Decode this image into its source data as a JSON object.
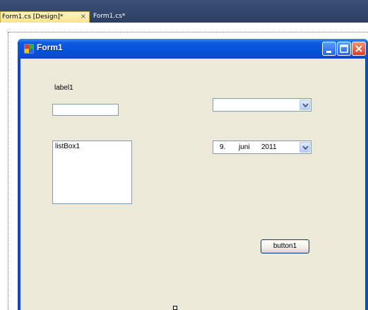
{
  "tabs": [
    {
      "label": "Form1.cs [Design]*",
      "active": true,
      "close_glyph": "×"
    },
    {
      "label": "Form1.cs*",
      "active": false
    }
  ],
  "form": {
    "title": "Form1",
    "icon": "form-app-icon",
    "controls": {
      "label1": "label1",
      "textbox1_value": "",
      "listbox1_items": [
        "listBox1"
      ],
      "combobox1_value": "",
      "datepicker1": {
        "day": "9.",
        "month": "juni",
        "year": "2011"
      },
      "button1": "button1"
    }
  },
  "colors": {
    "tabstrip_bg": "#2d3f63",
    "active_tab": "#fbe289",
    "form_titlebar": "#0851d4",
    "form_client": "#ece9d8",
    "close_button": "#d8402a"
  }
}
